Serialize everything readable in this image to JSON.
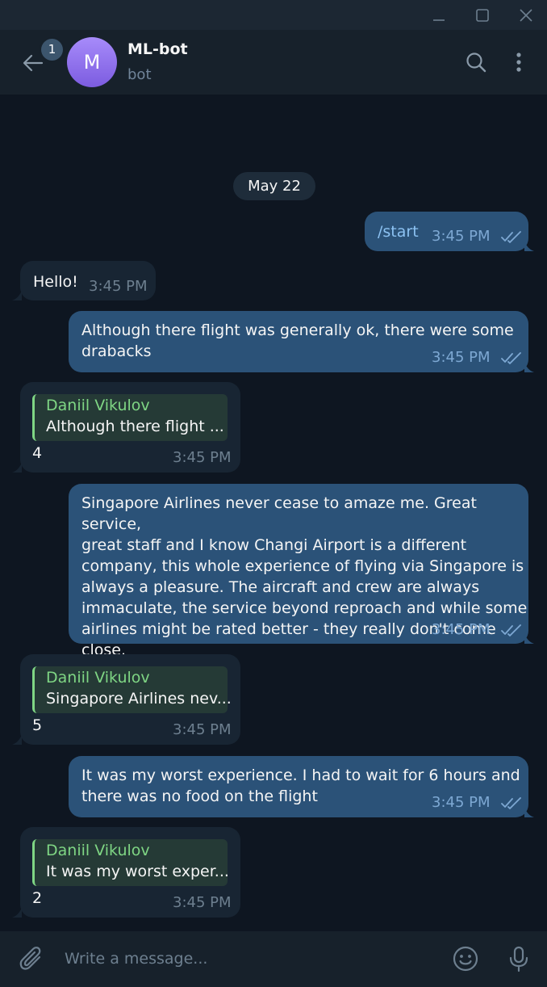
{
  "chat": {
    "title": "ML-bot",
    "status": "bot",
    "avatar_letter": "M",
    "unread_count": "1"
  },
  "date_separator": "May 22",
  "messages": [
    {
      "kind": "outgoing",
      "text": "/start",
      "time": "3:45 PM",
      "read": true
    },
    {
      "kind": "incoming",
      "text": "Hello!",
      "time": "3:45 PM"
    },
    {
      "kind": "outgoing",
      "text": "Although there flight was generally ok, there were some\ndrabacks",
      "time": "3:45 PM",
      "read": true
    },
    {
      "kind": "incoming",
      "reply_to": {
        "name": "Daniil Vikulov",
        "text": "Although there flight ..."
      },
      "text": "4",
      "time": "3:45 PM"
    },
    {
      "kind": "outgoing",
      "text": "Singapore Airlines never cease to amaze me. Great service,\ngreat staff and I know Changi Airport is a different\ncompany, this whole experience of flying via Singapore is\nalways a pleasure. The aircraft and crew are always\nimmaculate, the service beyond reproach and while some\nairlines might be rated better - they really don't come close.",
      "time": "3:45 PM",
      "read": true
    },
    {
      "kind": "incoming",
      "reply_to": {
        "name": "Daniil Vikulov",
        "text": "Singapore Airlines nev..."
      },
      "text": "5",
      "time": "3:45 PM"
    },
    {
      "kind": "outgoing",
      "text": "It was my worst experience. I had to wait for 6 hours and\nthere was no food on the flight",
      "time": "3:45 PM",
      "read": true
    },
    {
      "kind": "incoming",
      "reply_to": {
        "name": "Daniil Vikulov",
        "text": "It was my worst exper..."
      },
      "text": "2",
      "time": "3:45 PM"
    }
  ],
  "composer": {
    "placeholder": "Write a message..."
  },
  "icons": {
    "window": [
      "minimize-icon",
      "maximize-icon",
      "close-icon"
    ],
    "header": [
      "back-arrow-icon",
      "search-icon",
      "more-vertical-icon"
    ],
    "composer": [
      "paperclip-icon",
      "emoji-icon",
      "microphone-icon"
    ],
    "read_receipt": "double-check-icon"
  },
  "colors": {
    "background": "#0e1621",
    "header": "#17212b",
    "outgoing_bubble": "#2b5278",
    "incoming_bubble": "#182533",
    "reply_accent": "#7fd684",
    "avatar": "#8b6cf0"
  }
}
